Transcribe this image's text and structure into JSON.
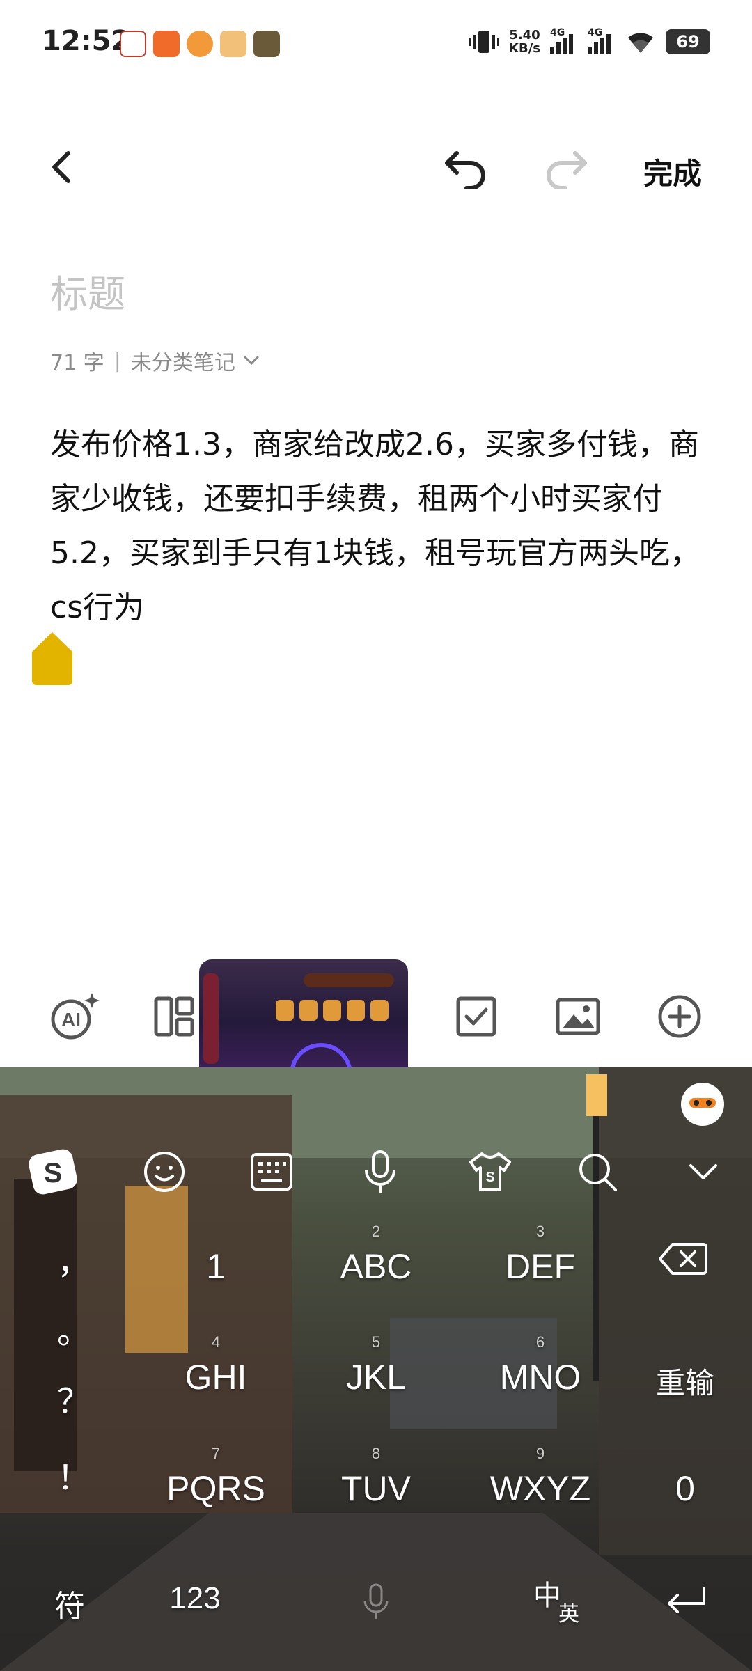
{
  "status_bar": {
    "time": "12:52",
    "speed_value": "5.40",
    "speed_unit": "KB/s",
    "network_1": "4G",
    "network_2": "4G",
    "battery": "69"
  },
  "nav": {
    "done_label": "完成"
  },
  "note": {
    "title_placeholder": "标题",
    "word_count": "71 字",
    "category": "未分类笔记",
    "body": "发布价格1.3，商家给改成2.6，买家多付钱，商家少收钱，还要扣手续费，租两个小时买家付5.2，买家到手只有1块钱，租号玩官方两头吃，cs行为"
  },
  "toolbar": {
    "ai_label": "AI"
  },
  "keyboard": {
    "punct": [
      "，",
      "。",
      "？",
      "！"
    ],
    "row1": [
      {
        "num": "",
        "label": "1"
      },
      {
        "num": "2",
        "label": "ABC"
      },
      {
        "num": "3",
        "label": "DEF"
      }
    ],
    "row2": [
      {
        "num": "4",
        "label": "GHI"
      },
      {
        "num": "5",
        "label": "JKL"
      },
      {
        "num": "6",
        "label": "MNO"
      },
      {
        "num": "",
        "label": "重输"
      }
    ],
    "row3": [
      {
        "num": "7",
        "label": "PQRS"
      },
      {
        "num": "8",
        "label": "TUV"
      },
      {
        "num": "9",
        "label": "WXYZ"
      },
      {
        "num": "",
        "label": "0"
      }
    ],
    "bottom": {
      "symbols": "符",
      "numbers": "123",
      "lang_main": "中",
      "lang_sub": "英"
    }
  },
  "colors": {
    "cursor_handle": "#e2b400",
    "placeholder": "#c4c4c4",
    "redo_disabled": "#c8c8c8"
  }
}
